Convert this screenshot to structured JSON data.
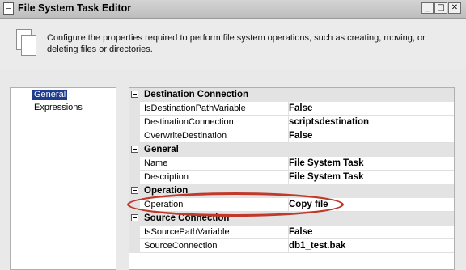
{
  "window": {
    "title": "File System Task Editor",
    "controls": {
      "minimize": "_",
      "maximize": "□",
      "close": "✕"
    }
  },
  "header": {
    "description": "Configure the properties required to perform file system operations, such as creating, moving, or deleting files or directories."
  },
  "nav": {
    "items": [
      {
        "label": "General",
        "selected": true
      },
      {
        "label": "Expressions",
        "selected": false
      }
    ]
  },
  "properties": {
    "categories": [
      {
        "label": "Destination Connection",
        "rows": [
          {
            "name": "IsDestinationPathVariable",
            "value": "False"
          },
          {
            "name": "DestinationConnection",
            "value": "scriptsdestination"
          },
          {
            "name": "OverwriteDestination",
            "value": "False"
          }
        ]
      },
      {
        "label": "General",
        "rows": [
          {
            "name": "Name",
            "value": "File System Task"
          },
          {
            "name": "Description",
            "value": "File System Task"
          }
        ]
      },
      {
        "label": "Operation",
        "rows": [
          {
            "name": "Operation",
            "value": "Copy file"
          }
        ]
      },
      {
        "label": "Source Connection",
        "rows": [
          {
            "name": "IsSourcePathVariable",
            "value": "False"
          },
          {
            "name": "SourceConnection",
            "value": "db1_test.bak"
          }
        ]
      }
    ]
  },
  "colors": {
    "highlight_ring": "#c0392b",
    "selection": "#1f3c8f"
  }
}
